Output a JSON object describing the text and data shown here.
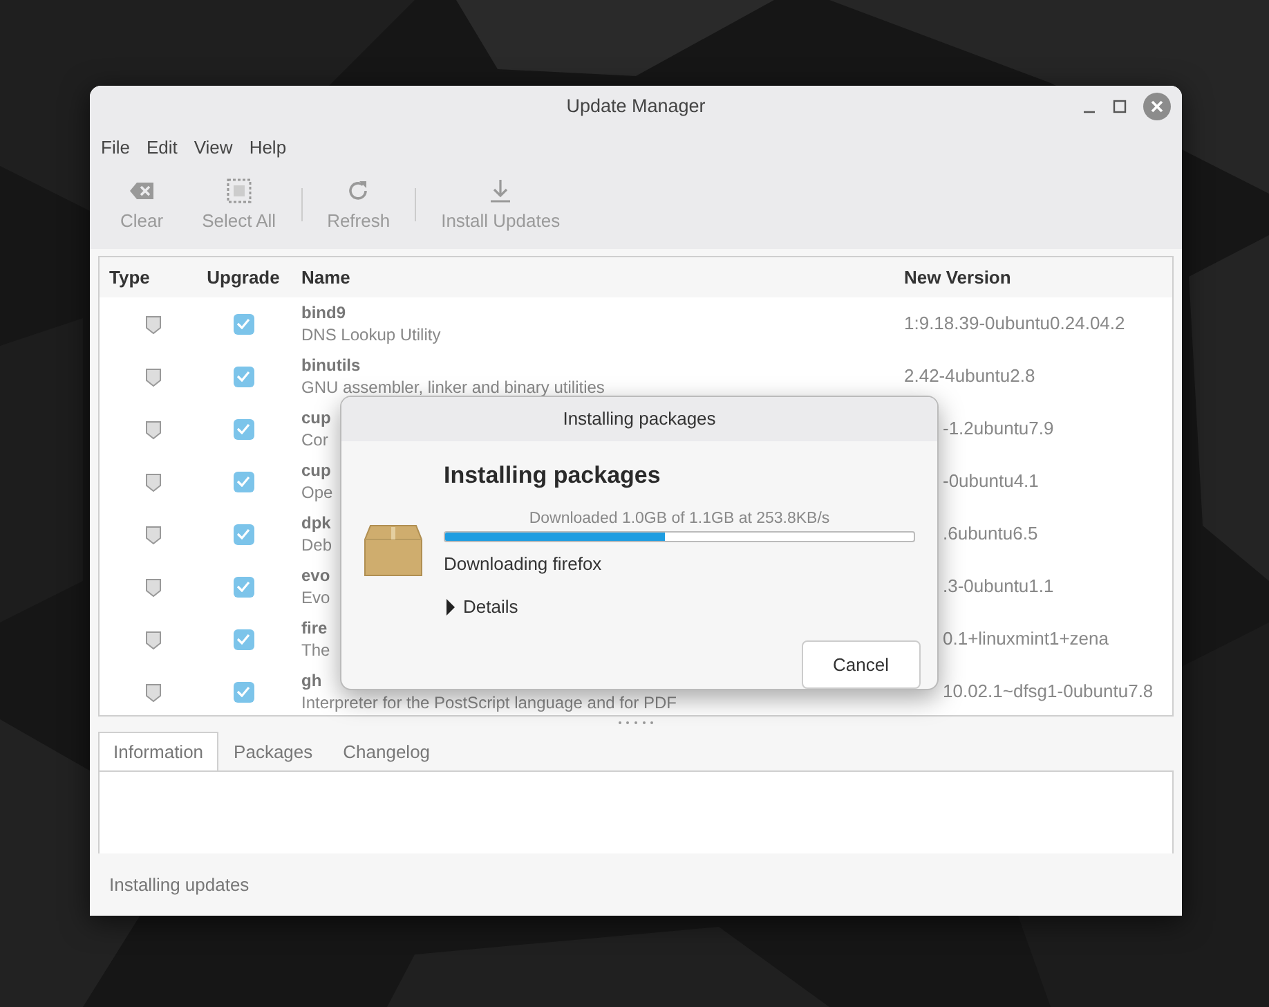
{
  "window": {
    "title": "Update Manager"
  },
  "menu": [
    "File",
    "Edit",
    "View",
    "Help"
  ],
  "toolbar": [
    {
      "label": "Clear",
      "kind": "clear",
      "disabled": true
    },
    {
      "label": "Select All",
      "kind": "select-all",
      "disabled": true
    },
    {
      "label": "Refresh",
      "kind": "refresh",
      "disabled": true
    },
    {
      "label": "Install Updates",
      "kind": "install",
      "disabled": true
    }
  ],
  "table": {
    "columns": [
      "Type",
      "Upgrade",
      "Name",
      "New Version"
    ],
    "rows": [
      {
        "name": "bind9",
        "description": "DNS Lookup Utility",
        "version": "1:9.18.39-0ubuntu0.24.04.2",
        "checked": true
      },
      {
        "name": "binutils",
        "description": "GNU assembler, linker and binary utilities",
        "version": "2.42-4ubuntu2.8",
        "checked": true
      },
      {
        "name": "cup",
        "description": "Cor",
        "version": "-1.2ubuntu7.9",
        "checked": true
      },
      {
        "name": "cup",
        "description": "Ope",
        "version": "-0ubuntu4.1",
        "checked": true
      },
      {
        "name": "dpk",
        "description": "Deb",
        "version": ".6ubuntu6.5",
        "checked": true
      },
      {
        "name": "evo",
        "description": "Evo",
        "version": ".3-0ubuntu1.1",
        "checked": true
      },
      {
        "name": "fire",
        "description": "The",
        "version": "0.1+linuxmint1+zena",
        "checked": true
      },
      {
        "name": "gh",
        "description": "Interpreter for the PostScript language and for PDF",
        "version": "10.02.1~dfsg1-0ubuntu7.8",
        "checked": true
      }
    ]
  },
  "tabs": [
    {
      "label": "Information",
      "selected": true
    },
    {
      "label": "Packages",
      "selected": false
    },
    {
      "label": "Changelog",
      "selected": false
    }
  ],
  "status_bar": "Installing updates",
  "dialog": {
    "title": "Installing packages",
    "heading": "Installing packages",
    "progress_text": "Downloaded 1.0GB of 1.1GB at 253.8KB/s",
    "level": 0.47,
    "status": "Downloading firefox",
    "details": {
      "label": "Details",
      "expanded": false
    },
    "buttons": [
      "Cancel"
    ]
  }
}
